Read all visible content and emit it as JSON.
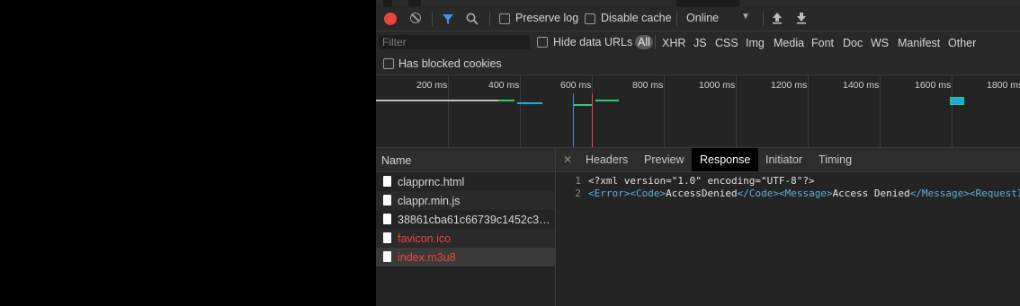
{
  "toolbar": {
    "preserve_log": "Preserve log",
    "disable_cache": "Disable cache",
    "throttling": "Online"
  },
  "filterbar": {
    "filter_placeholder": "Filter",
    "hide_data_urls": "Hide data URLs",
    "types": [
      "All",
      "XHR",
      "JS",
      "CSS",
      "Img",
      "Media",
      "Font",
      "Doc",
      "WS",
      "Manifest",
      "Other"
    ],
    "has_blocked_cookies": "Has blocked cookies"
  },
  "timeline": {
    "ticks": [
      "200 ms",
      "400 ms",
      "600 ms",
      "800 ms",
      "1000 ms",
      "1200 ms",
      "1400 ms",
      "1600 ms",
      "1800 ms"
    ]
  },
  "requests": {
    "header": "Name",
    "rows": [
      {
        "name": "clapprnc.html",
        "error": false
      },
      {
        "name": "clappr.min.js",
        "error": false
      },
      {
        "name": "38861cba61c66739c1452c3…",
        "error": false
      },
      {
        "name": "favicon.ico",
        "error": true
      },
      {
        "name": "index.m3u8",
        "error": true
      }
    ]
  },
  "detail": {
    "tabs": [
      "Headers",
      "Preview",
      "Response",
      "Initiator",
      "Timing"
    ],
    "active_tab": "Response",
    "response": {
      "line1_no": "1",
      "line1": "<?xml version=\"1.0\" encoding=\"UTF-8\"?>",
      "line2_no": "2",
      "line2_parts": [
        "<Error>",
        "<Code>",
        "AccessDenied",
        "</Code>",
        "<Message>",
        "Access Denied",
        "</Message>",
        "<RequestI"
      ]
    }
  },
  "colors": {
    "record": "#e8453c",
    "error_text": "#e8453c",
    "xml_tag": "#5db0d7"
  }
}
